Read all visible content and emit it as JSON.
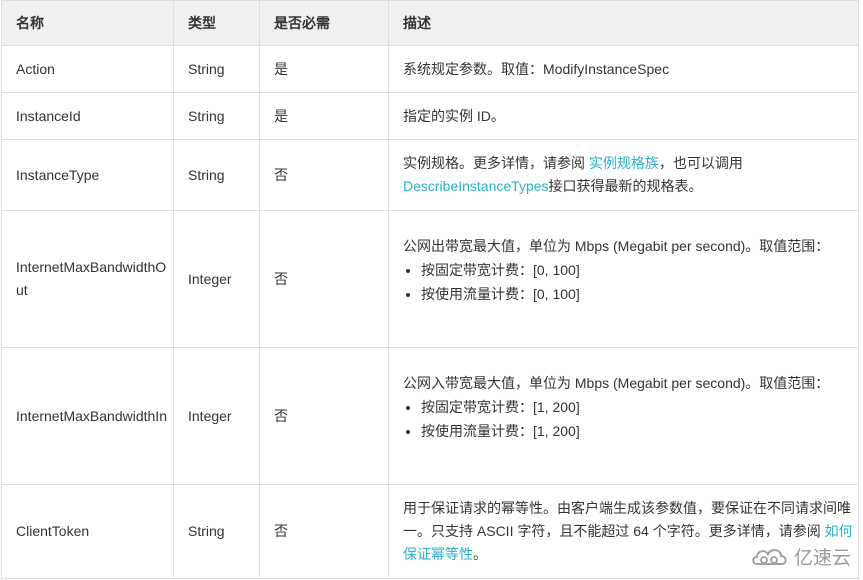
{
  "table": {
    "headers": [
      "名称",
      "类型",
      "是否必需",
      "描述"
    ],
    "rows": [
      {
        "name": "Action",
        "type": "String",
        "required": "是",
        "desc": {
          "text_before": "系统规定参数。取值：ModifyInstanceSpec"
        }
      },
      {
        "name": "InstanceId",
        "type": "String",
        "required": "是",
        "desc": {
          "text_before": "指定的实例 ID。"
        }
      },
      {
        "name": "InstanceType",
        "type": "String",
        "required": "否",
        "desc": {
          "text_before": "实例规格。更多详情，请参阅 ",
          "link1": "实例规格族",
          "text_mid": "，也可以调用 ",
          "link2": "DescribeInstanceTypes",
          "text_after": "接口获得最新的规格表。"
        }
      },
      {
        "name": "InternetMaxBandwidthOut",
        "type": "Integer",
        "required": "否",
        "desc": {
          "text_before": "公网出带宽最大值，单位为 Mbps (Megabit per second)。取值范围：",
          "bullets": [
            "按固定带宽计费：[0, 100]",
            "按使用流量计费：[0, 100]"
          ]
        }
      },
      {
        "name": "InternetMaxBandwidthIn",
        "type": "Integer",
        "required": "否",
        "desc": {
          "text_before": "公网入带宽最大值，单位为 Mbps (Megabit per second)。取值范围：",
          "bullets": [
            "按固定带宽计费：[1, 200]",
            "按使用流量计费：[1, 200]"
          ]
        }
      },
      {
        "name": "ClientToken",
        "type": "String",
        "required": "否",
        "desc": {
          "text_before": "用于保证请求的幂等性。由客户端生成该参数值，要保证在不同请求间唯一。只支持 ASCII 字符，且不能超过 64 个字符。更多详情，请参阅 ",
          "link1": "如何保证幂等性",
          "text_after": "。"
        }
      }
    ]
  },
  "watermark": {
    "icon": "cloud-logo-icon",
    "text": "亿速云"
  },
  "colors": {
    "link": "#2bb0cc",
    "header_bg": "#f0f0f0",
    "border": "#dddddd"
  }
}
